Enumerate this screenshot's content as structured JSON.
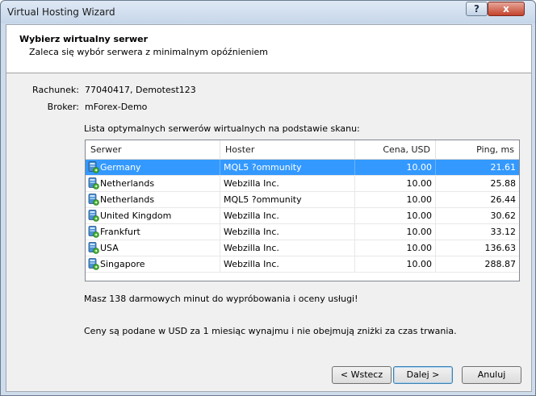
{
  "window": {
    "title": "Virtual Hosting Wizard",
    "help_glyph": "?",
    "close_glyph": "x"
  },
  "header": {
    "title": "Wybierz wirtualny serwer",
    "subtitle": "Zaleca się wybór serwera z minimalnym opóźnieniem"
  },
  "account": {
    "label": "Rachunek:",
    "value": "77040417, Demotest123"
  },
  "broker": {
    "label": "Broker:",
    "value": "mForex-Demo"
  },
  "list_caption": "Lista optymalnych serwerów wirtualnych na podstawie skanu:",
  "table": {
    "columns": [
      "Serwer",
      "Hoster",
      "Cena, USD",
      "Ping, ms"
    ],
    "rows": [
      {
        "server": "Germany",
        "hoster": "MQL5 ?ommunity",
        "price": "10.00",
        "ping": "21.61",
        "selected": true
      },
      {
        "server": "Netherlands",
        "hoster": "Webzilla Inc.",
        "price": "10.00",
        "ping": "25.88"
      },
      {
        "server": "Netherlands",
        "hoster": "MQL5 ?ommunity",
        "price": "10.00",
        "ping": "26.44"
      },
      {
        "server": "United Kingdom",
        "hoster": "Webzilla Inc.",
        "price": "10.00",
        "ping": "30.62"
      },
      {
        "server": "Frankfurt",
        "hoster": "Webzilla Inc.",
        "price": "10.00",
        "ping": "33.12"
      },
      {
        "server": "USA",
        "hoster": "Webzilla Inc.",
        "price": "10.00",
        "ping": "136.63"
      },
      {
        "server": "Singapore",
        "hoster": "Webzilla Inc.",
        "price": "10.00",
        "ping": "288.87"
      }
    ]
  },
  "info": {
    "free_minutes": "Masz 138 darmowych minut do wypróbowania i oceny usługi!",
    "prices_note": "Ceny są podane w USD za 1 miesiąc wynajmu i nie obejmują zniżki za czas trwania."
  },
  "buttons": {
    "back": "< Wstecz",
    "next": "Dalej >",
    "cancel": "Anuluj"
  },
  "colors": {
    "selection": "#3399ff",
    "server_icon": "#4a8fd0",
    "server_icon_badge": "#3fae2a"
  }
}
